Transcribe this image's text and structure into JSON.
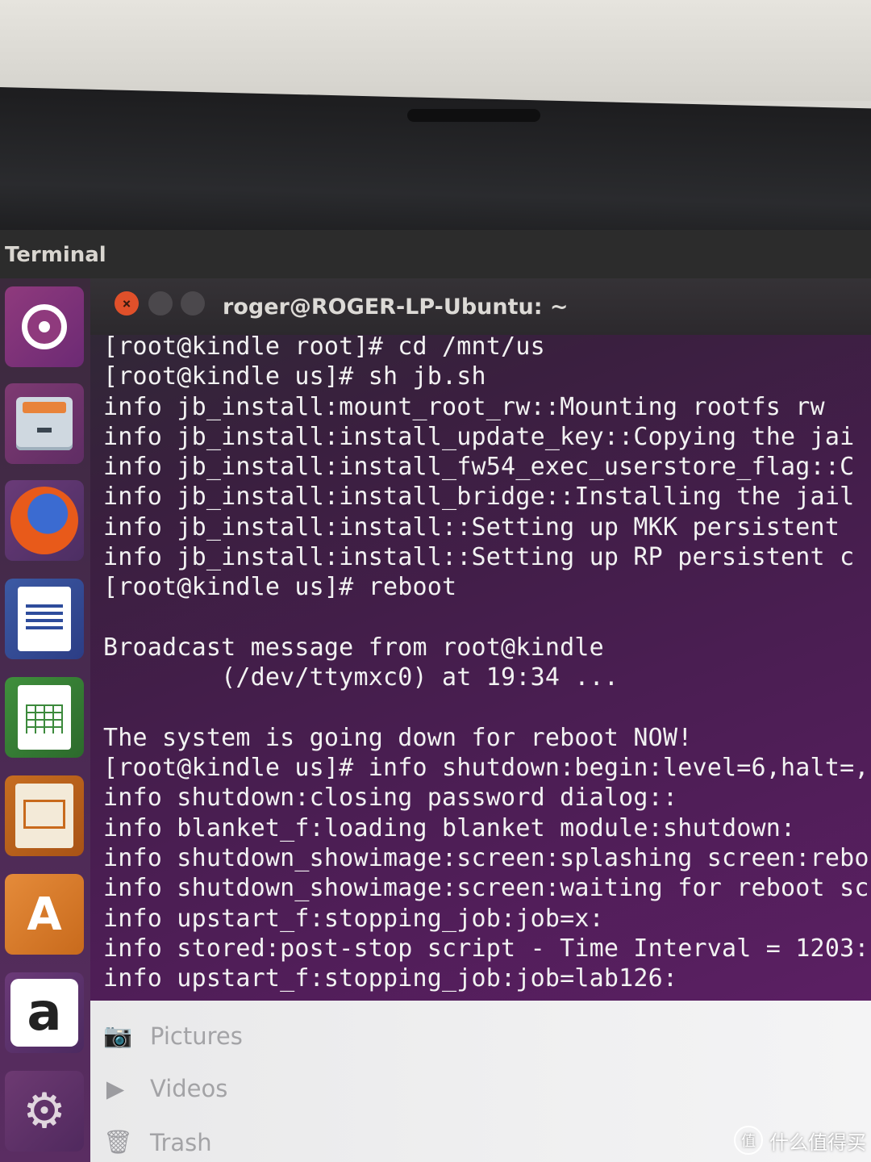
{
  "panel": {
    "title": "Terminal"
  },
  "launcher": [
    {
      "name": "ubuntu-dash"
    },
    {
      "name": "files"
    },
    {
      "name": "firefox"
    },
    {
      "name": "libreoffice-writer"
    },
    {
      "name": "libreoffice-calc"
    },
    {
      "name": "libreoffice-impress"
    },
    {
      "name": "ubuntu-software-center",
      "glyph": "A"
    },
    {
      "name": "amazon",
      "glyph": "a"
    },
    {
      "name": "system-settings"
    }
  ],
  "window": {
    "title": "roger@ROGER-LP-Ubuntu: ~",
    "close_glyph": "×"
  },
  "terminal": {
    "lines": [
      "[root@kindle root]# cd /mnt/us",
      "[root@kindle us]# sh jb.sh",
      "info jb_install:mount_root_rw::Mounting rootfs rw",
      "info jb_install:install_update_key::Copying the jai",
      "info jb_install:install_fw54_exec_userstore_flag::C",
      "info jb_install:install_bridge::Installing the jail",
      "info jb_install:install::Setting up MKK persistent",
      "info jb_install:install::Setting up RP persistent c",
      "[root@kindle us]# reboot",
      "",
      "Broadcast message from root@kindle",
      "        (/dev/ttymxc0) at 19:34 ...",
      "",
      "The system is going down for reboot NOW!",
      "[root@kindle us]# info shutdown:begin:level=6,halt=,",
      "info shutdown:closing password dialog::",
      "info blanket_f:loading blanket module:shutdown:",
      "info shutdown_showimage:screen:splashing screen:rebo",
      "info shutdown_showimage:screen:waiting for reboot sc",
      "info upstart_f:stopping_job:job=x:",
      "info stored:post-stop script - Time Interval = 1203:",
      "info upstart_f:stopping_job:job=lab126:"
    ]
  },
  "file_manager": {
    "places": [
      {
        "label": "Pictures",
        "icon": "camera-icon",
        "glyph": "📷"
      },
      {
        "label": "Videos",
        "icon": "video-icon",
        "glyph": "▶"
      },
      {
        "label": "Trash",
        "icon": "trash-icon",
        "glyph": "🗑"
      }
    ]
  },
  "watermark": {
    "badge": "值",
    "text": "什么值得买"
  }
}
